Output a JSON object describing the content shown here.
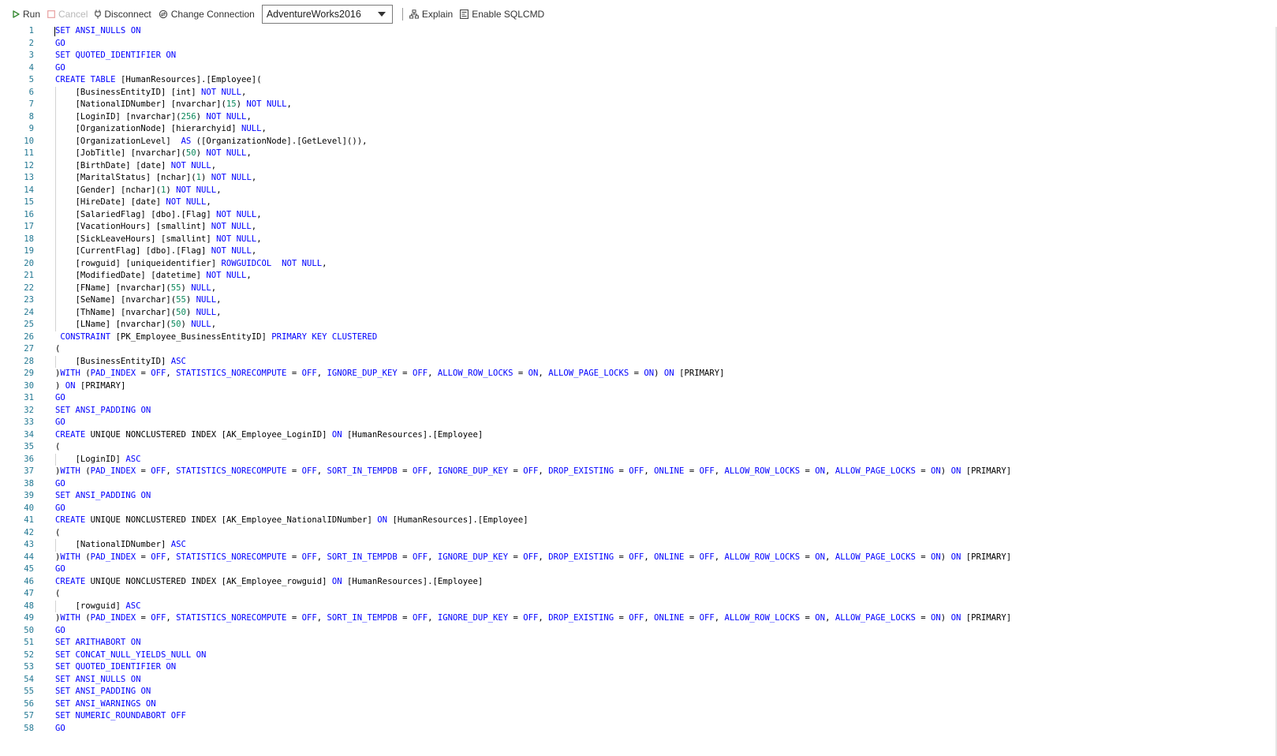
{
  "toolbar": {
    "run_label": "Run",
    "cancel_label": "Cancel",
    "disconnect_label": "Disconnect",
    "change_connection_label": "Change Connection",
    "database": "AdventureWorks2016",
    "explain_label": "Explain",
    "sqlcmd_label": "Enable SQLCMD"
  },
  "colors": {
    "keyword": "#0000ff",
    "number": "#09885a",
    "line_number": "#237893",
    "run_icon": "#388a34"
  },
  "icons": {
    "run": "play-icon",
    "cancel": "stop-icon",
    "disconnect": "plug-icon",
    "change_connection": "connection-icon",
    "explain": "explain-icon",
    "sqlcmd": "sqlcmd-icon",
    "dropdown": "chevron-down-icon"
  },
  "editor": {
    "lines": [
      "SET ANSI_NULLS ON",
      "GO",
      "SET QUOTED_IDENTIFIER ON",
      "GO",
      "CREATE TABLE [HumanResources].[Employee](",
      "    [BusinessEntityID] [int] NOT NULL,",
      "    [NationalIDNumber] [nvarchar](15) NOT NULL,",
      "    [LoginID] [nvarchar](256) NOT NULL,",
      "    [OrganizationNode] [hierarchyid] NULL,",
      "    [OrganizationLevel]  AS ([OrganizationNode].[GetLevel]()),",
      "    [JobTitle] [nvarchar](50) NOT NULL,",
      "    [BirthDate] [date] NOT NULL,",
      "    [MaritalStatus] [nchar](1) NOT NULL,",
      "    [Gender] [nchar](1) NOT NULL,",
      "    [HireDate] [date] NOT NULL,",
      "    [SalariedFlag] [dbo].[Flag] NOT NULL,",
      "    [VacationHours] [smallint] NOT NULL,",
      "    [SickLeaveHours] [smallint] NOT NULL,",
      "    [CurrentFlag] [dbo].[Flag] NOT NULL,",
      "    [rowguid] [uniqueidentifier] ROWGUIDCOL  NOT NULL,",
      "    [ModifiedDate] [datetime] NOT NULL,",
      "    [FName] [nvarchar](55) NULL,",
      "    [SeName] [nvarchar](55) NULL,",
      "    [ThName] [nvarchar](50) NULL,",
      "    [LName] [nvarchar](50) NULL,",
      " CONSTRAINT [PK_Employee_BusinessEntityID] PRIMARY KEY CLUSTERED",
      "(",
      "    [BusinessEntityID] ASC",
      ")WITH (PAD_INDEX = OFF, STATISTICS_NORECOMPUTE = OFF, IGNORE_DUP_KEY = OFF, ALLOW_ROW_LOCKS = ON, ALLOW_PAGE_LOCKS = ON) ON [PRIMARY]",
      ") ON [PRIMARY]",
      "GO",
      "SET ANSI_PADDING ON",
      "GO",
      "CREATE UNIQUE NONCLUSTERED INDEX [AK_Employee_LoginID] ON [HumanResources].[Employee]",
      "(",
      "    [LoginID] ASC",
      ")WITH (PAD_INDEX = OFF, STATISTICS_NORECOMPUTE = OFF, SORT_IN_TEMPDB = OFF, IGNORE_DUP_KEY = OFF, DROP_EXISTING = OFF, ONLINE = OFF, ALLOW_ROW_LOCKS = ON, ALLOW_PAGE_LOCKS = ON) ON [PRIMARY]",
      "GO",
      "SET ANSI_PADDING ON",
      "GO",
      "CREATE UNIQUE NONCLUSTERED INDEX [AK_Employee_NationalIDNumber] ON [HumanResources].[Employee]",
      "(",
      "    [NationalIDNumber] ASC",
      ")WITH (PAD_INDEX = OFF, STATISTICS_NORECOMPUTE = OFF, SORT_IN_TEMPDB = OFF, IGNORE_DUP_KEY = OFF, DROP_EXISTING = OFF, ONLINE = OFF, ALLOW_ROW_LOCKS = ON, ALLOW_PAGE_LOCKS = ON) ON [PRIMARY]",
      "GO",
      "CREATE UNIQUE NONCLUSTERED INDEX [AK_Employee_rowguid] ON [HumanResources].[Employee]",
      "(",
      "    [rowguid] ASC",
      ")WITH (PAD_INDEX = OFF, STATISTICS_NORECOMPUTE = OFF, SORT_IN_TEMPDB = OFF, IGNORE_DUP_KEY = OFF, DROP_EXISTING = OFF, ONLINE = OFF, ALLOW_ROW_LOCKS = ON, ALLOW_PAGE_LOCKS = ON) ON [PRIMARY]",
      "GO",
      "SET ARITHABORT ON",
      "SET CONCAT_NULL_YIELDS_NULL ON",
      "SET QUOTED_IDENTIFIER ON",
      "SET ANSI_NULLS ON",
      "SET ANSI_PADDING ON",
      "SET ANSI_WARNINGS ON",
      "SET NUMERIC_ROUNDABORT OFF",
      "GO"
    ]
  }
}
